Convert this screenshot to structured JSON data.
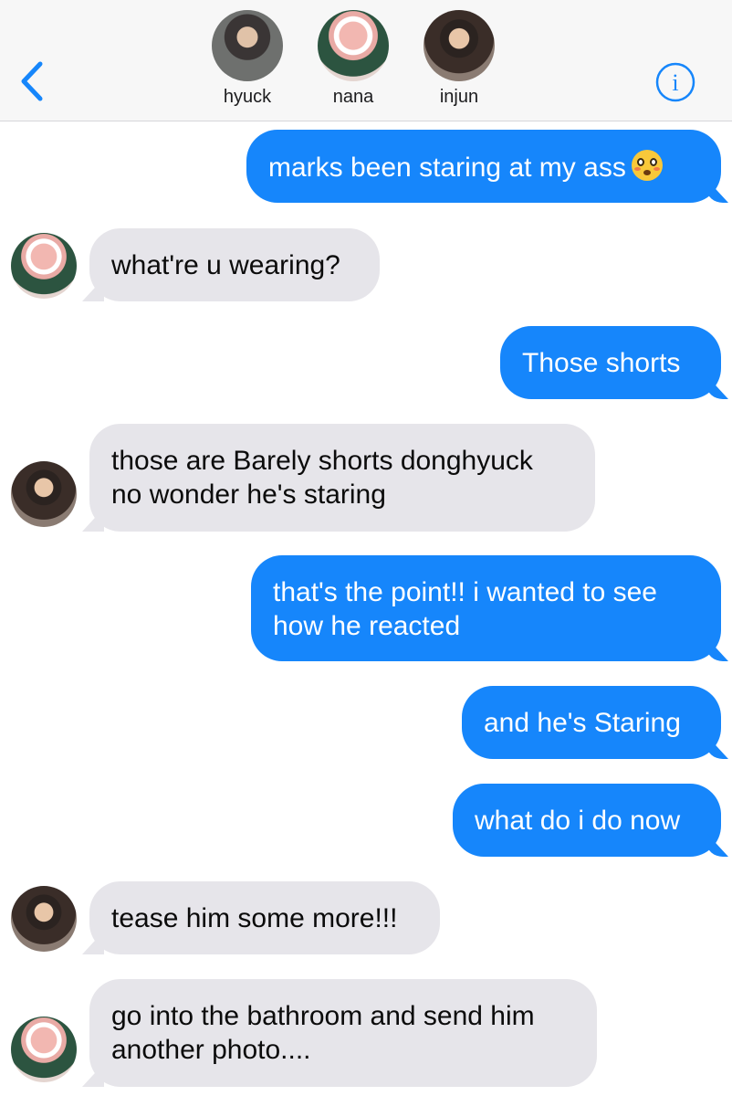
{
  "header": {
    "participants": [
      {
        "name": "hyuck"
      },
      {
        "name": "nana"
      },
      {
        "name": "injun"
      }
    ],
    "back_icon": "chevron-left-icon",
    "info_icon": "info-circle-icon",
    "accent_color": "#1686fb"
  },
  "messages": [
    {
      "from": "me",
      "text": "marks been staring at my ass",
      "emoji": "flushed-face"
    },
    {
      "from": "nana",
      "text": "what're u wearing?"
    },
    {
      "from": "me",
      "text": "Those shorts"
    },
    {
      "from": "injun",
      "line1": "those are Barely shorts donghyuck",
      "line2": "no wonder he's staring"
    },
    {
      "from": "me",
      "line1": "that's the point!! i wanted to see",
      "line2": "how he reacted"
    },
    {
      "from": "me",
      "text": "and he's Staring"
    },
    {
      "from": "me",
      "text": "what do i do now"
    },
    {
      "from": "injun",
      "text": "tease him some more!!!"
    },
    {
      "from": "nana",
      "line1": "go into the bathroom and send him",
      "line2": "another photo...."
    }
  ]
}
